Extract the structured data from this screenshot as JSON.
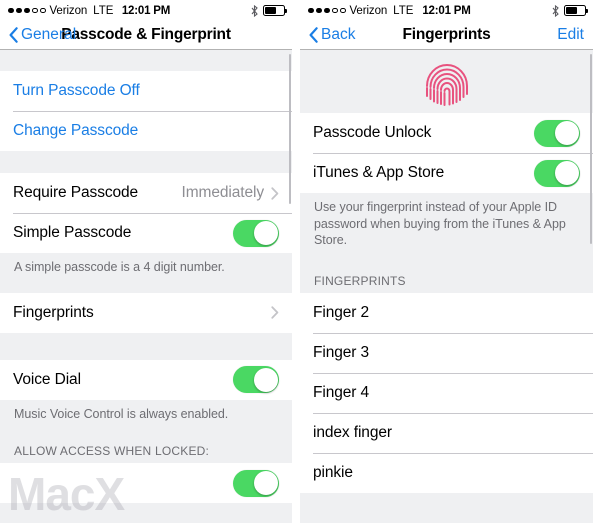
{
  "colors": {
    "accent_blue": "#1a7ee5",
    "toggle_green": "#4ad863",
    "group_bg": "#eff0f2",
    "separator": "#c8c7cc",
    "muted_text": "#6d6d72",
    "fingerprint_pink": "#e8527f"
  },
  "watermark": {
    "text": "MacX"
  },
  "left": {
    "statusbar": {
      "signal_filled": 3,
      "signal_empty": 2,
      "carrier": "Verizon",
      "network": "LTE",
      "time": "12:01 PM",
      "bluetooth_icon": "bluetooth-icon",
      "battery_icon": "battery-icon",
      "battery_level": 60
    },
    "nav": {
      "back_label": "General",
      "back_icon": "chevron-left-icon",
      "title": "Passcode & Fingerprint"
    },
    "groups": [
      {
        "rows": [
          {
            "label": "Turn Passcode Off",
            "type": "link"
          },
          {
            "label": "Change Passcode",
            "type": "link"
          }
        ]
      },
      {
        "rows": [
          {
            "label": "Require Passcode",
            "type": "disclosure",
            "value": "Immediately"
          },
          {
            "label": "Simple Passcode",
            "type": "toggle",
            "toggle_on": true
          }
        ],
        "note": "A simple passcode is a 4 digit number."
      },
      {
        "rows": [
          {
            "label": "Fingerprints",
            "type": "disclosure",
            "value": ""
          }
        ]
      },
      {
        "rows": [
          {
            "label": "Voice Dial",
            "type": "toggle",
            "toggle_on": true
          }
        ],
        "note": "Music Voice Control is always enabled."
      }
    ],
    "section_header": "ALLOW ACCESS WHEN LOCKED:",
    "clipped_row": {
      "label": "",
      "type": "toggle",
      "toggle_on": true
    }
  },
  "right": {
    "statusbar": {
      "signal_filled": 3,
      "signal_empty": 2,
      "carrier": "Verizon",
      "network": "LTE",
      "time": "12:01 PM",
      "bluetooth_icon": "bluetooth-icon",
      "battery_icon": "battery-icon",
      "battery_level": 60
    },
    "nav": {
      "back_label": "Back",
      "back_icon": "chevron-left-icon",
      "title": "Fingerprints",
      "edit_label": "Edit"
    },
    "hero_icon": "fingerprint-icon",
    "toggles": [
      {
        "label": "Passcode Unlock",
        "toggle_on": true
      },
      {
        "label": "iTunes & App Store",
        "toggle_on": true
      }
    ],
    "note": "Use your fingerprint instead of your Apple ID password when buying from the iTunes & App Store.",
    "section_header": "FINGERPRINTS",
    "fingerprints": [
      {
        "label": "Finger 2"
      },
      {
        "label": "Finger 3"
      },
      {
        "label": "Finger 4"
      },
      {
        "label": "index finger"
      },
      {
        "label": "pinkie"
      }
    ]
  }
}
